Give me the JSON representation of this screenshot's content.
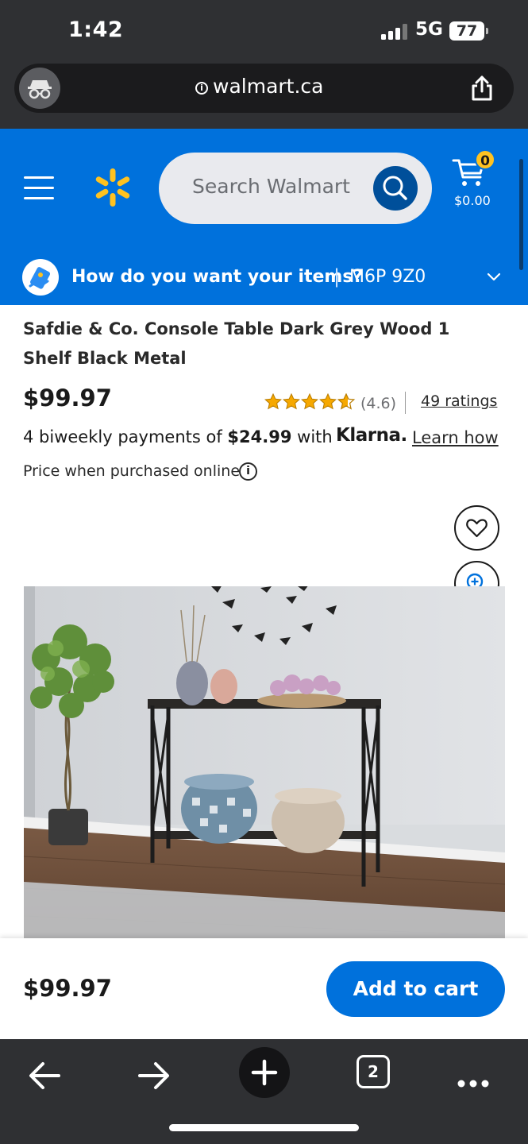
{
  "status_bar": {
    "time": "1:42",
    "network": "5G",
    "battery": "77"
  },
  "browser": {
    "url": "walmart.ca",
    "open_tabs": "2"
  },
  "header": {
    "search_placeholder": "Search Walmart",
    "cart_count": "0",
    "cart_total": "$0.00",
    "delivery_question": "How do you want your items?",
    "delivery_separator": "|",
    "postal_code": "M6P 9Z0",
    "colors": {
      "brand_blue": "#0071dc",
      "spark_yellow": "#ffc220",
      "search_button": "#004f9a"
    }
  },
  "product": {
    "title": "Safdie & Co. Console Table Dark Grey Wood 1 Shelf Black Metal",
    "price": "$99.97",
    "rating_stars": 4.6,
    "rating_value": "(4.6)",
    "ratings_link": "49 ratings",
    "payment_prefix": "4 biweekly payments of",
    "payment_amount": "$24.99",
    "payment_with": "with",
    "klarna_brand": "Klarna.",
    "learn_how": "Learn how",
    "price_note": "Price when purchased online",
    "info_glyph": "i"
  },
  "sticky_bar": {
    "price": "$99.97",
    "add_to_cart": "Add to cart"
  },
  "icons": [
    "incognito-icon",
    "info-icon",
    "share-icon",
    "menu-icon",
    "walmart-spark-icon",
    "search-icon",
    "cart-icon",
    "delivery-icon",
    "chevron-down-icon",
    "star-icon",
    "heart-icon",
    "zoom-in-icon",
    "back-arrow-icon",
    "forward-arrow-icon",
    "plus-icon",
    "tabs-icon",
    "more-icon"
  ]
}
